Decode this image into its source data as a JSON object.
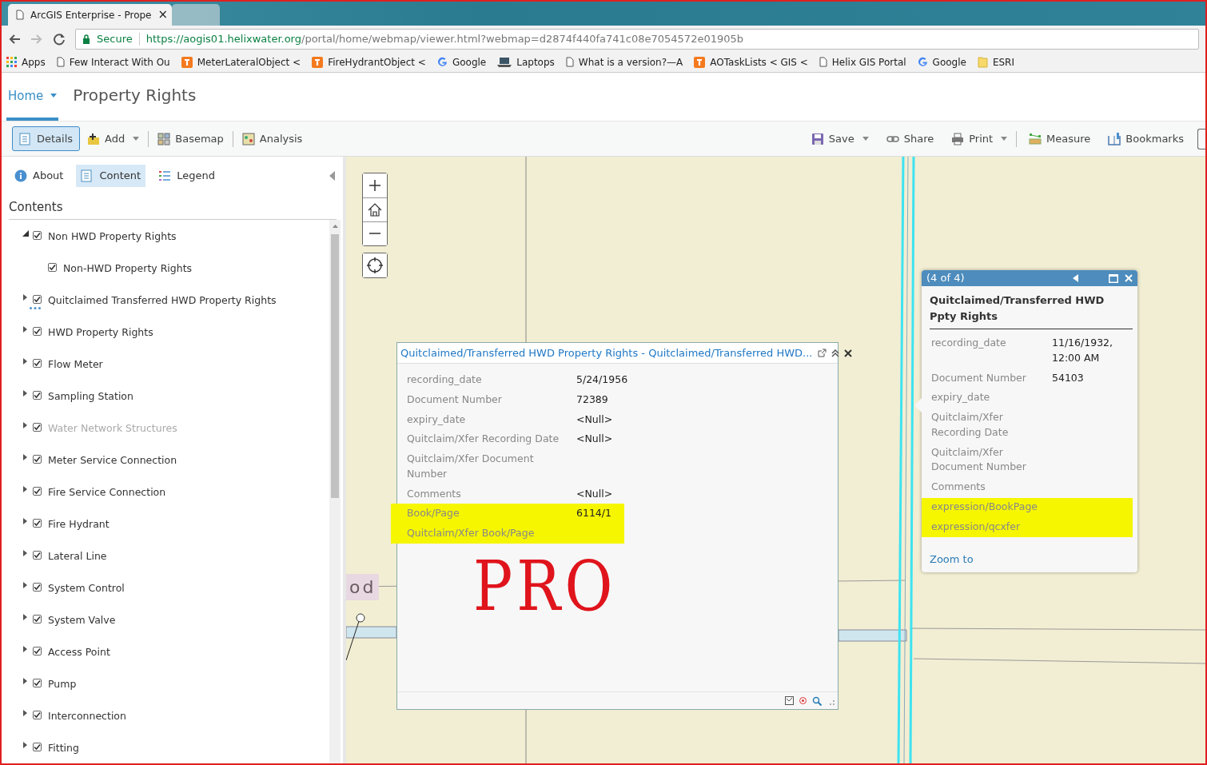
{
  "browser": {
    "tabs": [
      {
        "title": "ArcGIS Enterprise - Prope",
        "close": "×",
        "selected": true
      },
      {
        "selected": false
      }
    ],
    "address": {
      "secure_label": "Secure",
      "url_host": "https://aogis01.helixwater.org",
      "url_path": "/portal/home/webmap/viewer.html?webmap=d2874f440fa741c08e7054572e01905b"
    },
    "bookmarks": [
      {
        "kind": "apps",
        "label": "Apps"
      },
      {
        "kind": "page",
        "label": "Few Interact With Ou"
      },
      {
        "kind": "tool",
        "label": "MeterLateralObject <"
      },
      {
        "kind": "tool",
        "label": "FireHydrantObject <"
      },
      {
        "kind": "google",
        "label": "Google"
      },
      {
        "kind": "laptop",
        "label": "Laptops"
      },
      {
        "kind": "page",
        "label": "What is a version?—A"
      },
      {
        "kind": "tool",
        "label": "AOTaskLists < GIS <"
      },
      {
        "kind": "page",
        "label": "Helix GIS Portal"
      },
      {
        "kind": "google",
        "label": "Google"
      },
      {
        "kind": "folder",
        "label": "ESRI"
      }
    ]
  },
  "header": {
    "home": "Home",
    "title": "Property Rights"
  },
  "toolbar": {
    "left": [
      {
        "kind": "details",
        "label": "Details",
        "selected": true,
        "dropdown": false
      },
      {
        "kind": "add",
        "label": "Add",
        "selected": false,
        "dropdown": true
      },
      {
        "kind": "basemap",
        "label": "Basemap",
        "selected": false,
        "dropdown": false
      },
      {
        "kind": "analysis",
        "label": "Analysis",
        "selected": false,
        "dropdown": false
      }
    ],
    "right": [
      {
        "kind": "save",
        "label": "Save",
        "dropdown": true
      },
      {
        "kind": "share",
        "label": "Share",
        "dropdown": false
      },
      {
        "kind": "print",
        "label": "Print",
        "dropdown": true
      },
      {
        "kind": "measure",
        "label": "Measure",
        "dropdown": false
      },
      {
        "kind": "bookmarks",
        "label": "Bookmarks",
        "dropdown": false
      }
    ]
  },
  "panel": {
    "tabs": [
      {
        "kind": "about",
        "label": "About",
        "selected": false
      },
      {
        "kind": "content",
        "label": "Content",
        "selected": true
      },
      {
        "kind": "legend",
        "label": "Legend",
        "selected": false
      }
    ],
    "heading": "Contents",
    "layers": [
      {
        "name": "Non HWD Property Rights",
        "checked": true,
        "expanded": true,
        "disabled": false,
        "children": [
          {
            "name": "Non-HWD Property Rights",
            "checked": true,
            "disabled": false
          }
        ]
      },
      {
        "name": "Quitclaimed Transferred HWD Property Rights",
        "checked": true,
        "expanded": false,
        "disabled": false,
        "loading": true
      },
      {
        "name": "HWD Property Rights",
        "checked": true,
        "expanded": false,
        "disabled": false
      },
      {
        "name": "Flow Meter",
        "checked": true,
        "expanded": false,
        "disabled": false
      },
      {
        "name": "Sampling Station",
        "checked": true,
        "expanded": false,
        "disabled": false
      },
      {
        "name": "Water Network Structures",
        "checked": true,
        "expanded": false,
        "disabled": true
      },
      {
        "name": "Meter Service Connection",
        "checked": true,
        "expanded": false,
        "disabled": false
      },
      {
        "name": "Fire Service Connection",
        "checked": true,
        "expanded": false,
        "disabled": false
      },
      {
        "name": "Fire Hydrant",
        "checked": true,
        "expanded": false,
        "disabled": false
      },
      {
        "name": "Lateral Line",
        "checked": true,
        "expanded": false,
        "disabled": false
      },
      {
        "name": "System Control",
        "checked": true,
        "expanded": false,
        "disabled": false
      },
      {
        "name": "System Valve",
        "checked": true,
        "expanded": false,
        "disabled": false
      },
      {
        "name": "Access Point",
        "checked": true,
        "expanded": false,
        "disabled": false
      },
      {
        "name": "Pump",
        "checked": true,
        "expanded": false,
        "disabled": false
      },
      {
        "name": "Interconnection",
        "checked": true,
        "expanded": false,
        "disabled": false
      },
      {
        "name": "Fitting",
        "checked": true,
        "expanded": false,
        "disabled": false
      }
    ]
  },
  "map": {
    "label": "od",
    "docked_popup": {
      "title": "Quitclaimed/Transferred HWD Property Rights - Quitclaimed/Transferred HWD...",
      "fields": [
        {
          "name": "recording_date",
          "value": "5/24/1956",
          "highlighted": false
        },
        {
          "name": "Document Number",
          "value": "72389",
          "highlighted": false
        },
        {
          "name": "expiry_date",
          "value": "<Null>",
          "highlighted": false
        },
        {
          "name": "Quitclaim/Xfer Recording Date",
          "value": "<Null>",
          "highlighted": false
        },
        {
          "name": "Quitclaim/Xfer Document Number",
          "highlighted": false
        },
        {
          "name": "Comments",
          "value": "<Null>",
          "highlighted": false
        },
        {
          "name": "Book/Page",
          "value": "6114/1",
          "highlighted": true
        },
        {
          "name": "Quitclaim/Xfer Book/Page",
          "highlighted": true
        }
      ],
      "annotation": "PRO"
    },
    "popup": {
      "counter": "(4 of 4)",
      "title": "Quitclaimed/Transferred HWD Ppty Rights",
      "fields": [
        {
          "name": "recording_date",
          "value": "11/16/1932, 12:00 AM",
          "highlighted": false
        },
        {
          "name": "Document Number",
          "value": "54103",
          "highlighted": false
        },
        {
          "name": "expiry_date",
          "highlighted": false
        },
        {
          "name": "Quitclaim/Xfer Recording Date",
          "highlighted": false
        },
        {
          "name": "Quitclaim/Xfer Document Number",
          "highlighted": false
        },
        {
          "name": "Comments",
          "highlighted": false
        },
        {
          "name": "expression/BookPage",
          "highlighted": true
        },
        {
          "name": "expression/qcxfer",
          "highlighted": true
        }
      ],
      "link": "Zoom to"
    }
  }
}
